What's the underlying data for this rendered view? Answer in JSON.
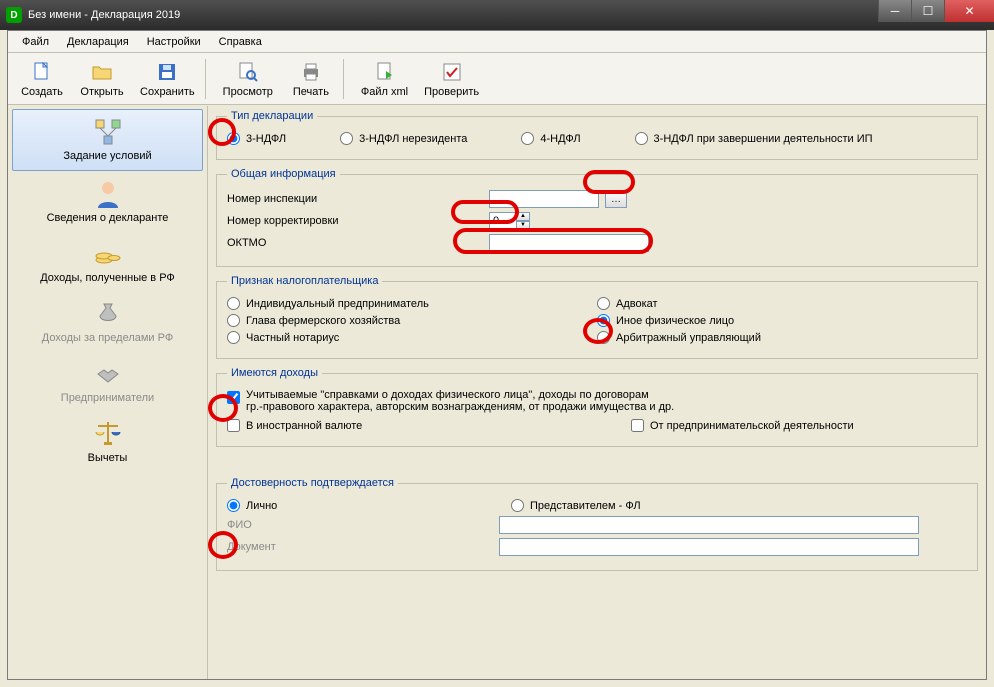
{
  "window": {
    "title": "Без имени - Декларация 2019"
  },
  "menu": {
    "file": "Файл",
    "declaration": "Декларация",
    "settings": "Настройки",
    "help": "Справка"
  },
  "toolbar": {
    "create": "Создать",
    "open": "Открыть",
    "save": "Сохранить",
    "preview": "Просмотр",
    "print": "Печать",
    "xml": "Файл xml",
    "check": "Проверить"
  },
  "sidebar": {
    "conditions": "Задание условий",
    "declarant": "Сведения о декларанте",
    "income_rf": "Доходы, полученные в РФ",
    "income_foreign": "Доходы за пределами РФ",
    "entrepreneurs": "Предприниматели",
    "deductions": "Вычеты"
  },
  "groups": {
    "decl_type": {
      "legend": "Тип декларации",
      "ndfl3": "3-НДФЛ",
      "ndfl3_nonres": "3-НДФЛ нерезидента",
      "ndfl4": "4-НДФЛ",
      "ndfl3_ip": "3-НДФЛ при завершении деятельности ИП"
    },
    "general": {
      "legend": "Общая информация",
      "inspection": "Номер инспекции",
      "correction": "Номер корректировки",
      "correction_value": "0",
      "oktmo": "ОКТМО",
      "inspection_value": "",
      "oktmo_value": ""
    },
    "taxpayer": {
      "legend": "Признак налогоплательщика",
      "ip": "Индивидуальный предприниматель",
      "farm": "Глава фермерского хозяйства",
      "notary": "Частный нотариус",
      "lawyer": "Адвокат",
      "person": "Иное физическое лицо",
      "arbitr": "Арбитражный управляющий"
    },
    "income": {
      "legend": "Имеются доходы",
      "cb1_a": "Учитываемые \"справками о доходах физического лица\", доходы по договорам",
      "cb1_b": "гр.-правового характера, авторским вознаграждениям, от продажи имущества и др.",
      "cb2": "В иностранной валюте",
      "cb3": "От предпринимательской деятельности"
    },
    "confirm": {
      "legend": "Достоверность подтверждается",
      "self": "Лично",
      "rep": "Представителем - ФЛ",
      "fio": "ФИО",
      "doc": "Документ",
      "fio_value": "",
      "doc_value": ""
    }
  }
}
